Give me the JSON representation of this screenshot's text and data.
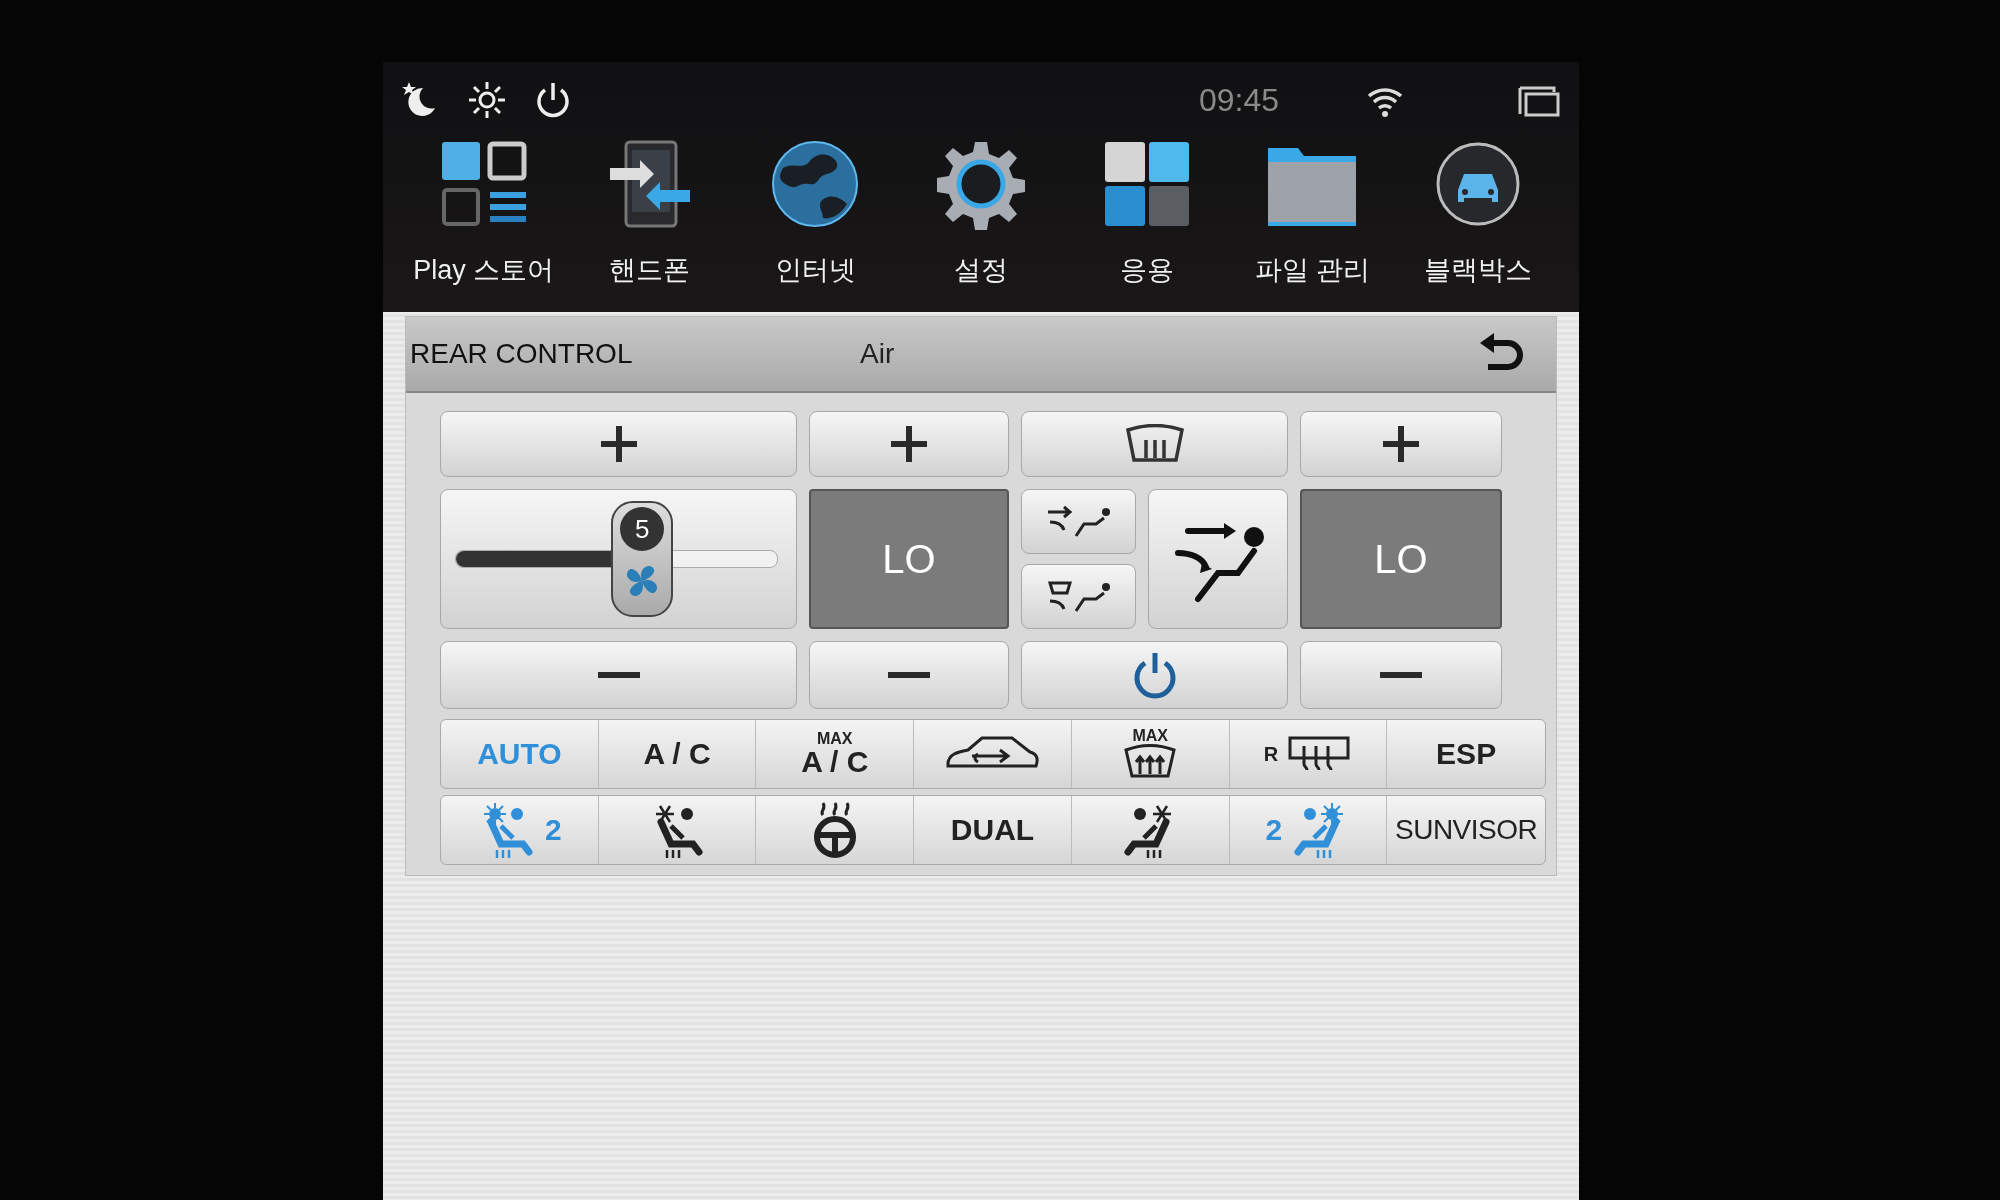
{
  "status_bar": {
    "time": "09:45"
  },
  "dock": [
    {
      "label": "Play 스토어",
      "kind": "store"
    },
    {
      "label": "핸드폰",
      "kind": "phone"
    },
    {
      "label": "인터넷",
      "kind": "globe"
    },
    {
      "label": "설정",
      "kind": "gear"
    },
    {
      "label": "응용",
      "kind": "apps"
    },
    {
      "label": "파일 관리",
      "kind": "folder"
    },
    {
      "label": "블랙박스",
      "kind": "car"
    }
  ],
  "header": {
    "title": "REAR CONTROL",
    "subtitle": "Air"
  },
  "fan": {
    "speed": "5",
    "level": 0.58
  },
  "temperature_left": "LO",
  "temperature_right": "LO",
  "function_rows": [
    [
      {
        "kind": "text",
        "text": "AUTO",
        "active": true
      },
      {
        "kind": "text",
        "text": "A / C",
        "active": false
      },
      {
        "kind": "max-text",
        "label": "MAX",
        "text": "A / C",
        "active": false
      },
      {
        "kind": "recirc",
        "active": false
      },
      {
        "kind": "max-defrost",
        "label": "MAX",
        "active": false
      },
      {
        "kind": "rear-defrost",
        "label": "R",
        "active": false
      },
      {
        "kind": "text",
        "text": "ESP",
        "active": false
      }
    ],
    [
      {
        "kind": "seat-heat-left",
        "text": "2",
        "active": true
      },
      {
        "kind": "seat-cool-left",
        "active": false
      },
      {
        "kind": "wheel-heat",
        "active": false
      },
      {
        "kind": "text",
        "text": "DUAL",
        "active": false
      },
      {
        "kind": "seat-cool-right",
        "active": false
      },
      {
        "kind": "seat-heat-right",
        "text": "2",
        "active": true
      },
      {
        "kind": "narrow-text",
        "text": "SUNVISOR",
        "active": false
      }
    ]
  ]
}
